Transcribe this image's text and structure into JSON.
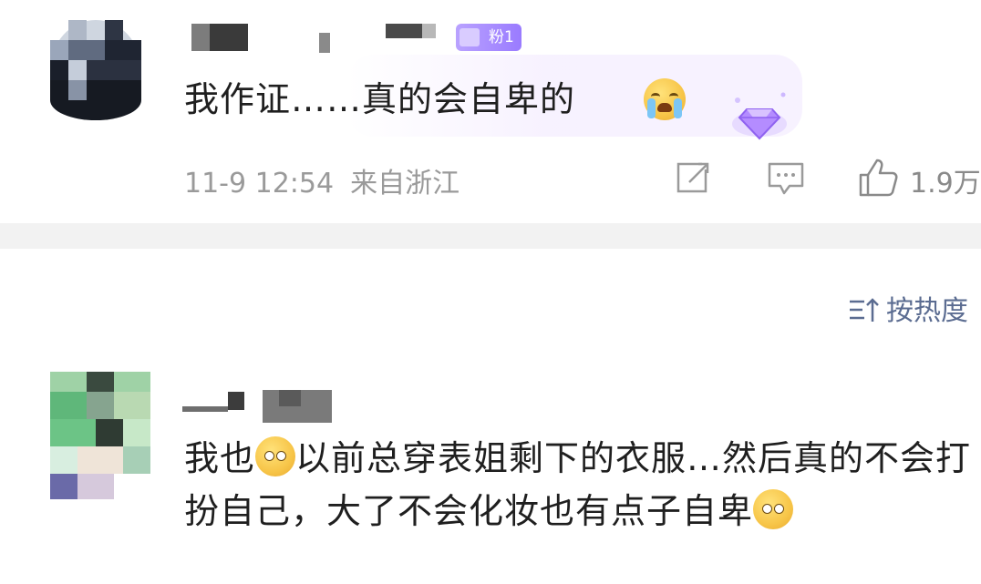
{
  "comment1": {
    "fan_badge": "粉1",
    "text": "我作证……真的会自卑的",
    "emoji": "crying-face",
    "time": "11-9 12:54",
    "location": "来自浙江",
    "likes": "1.9万"
  },
  "sort": {
    "icon": "sort-icon",
    "label": "按热度"
  },
  "comment2": {
    "line1": "我也",
    "line2": "以前总穿表姐剩下的衣服…然后真的不会打扮自己，大了不会化妆也有点子自卑",
    "emoji_1": "pleading-face",
    "emoji_2": "rolling-eyes-face"
  },
  "colors": {
    "accent_purple": "#9a7bff",
    "meta_gray": "#9a9a9a",
    "sort_blue": "#5b6c91",
    "divider": "#f2f2f2"
  }
}
